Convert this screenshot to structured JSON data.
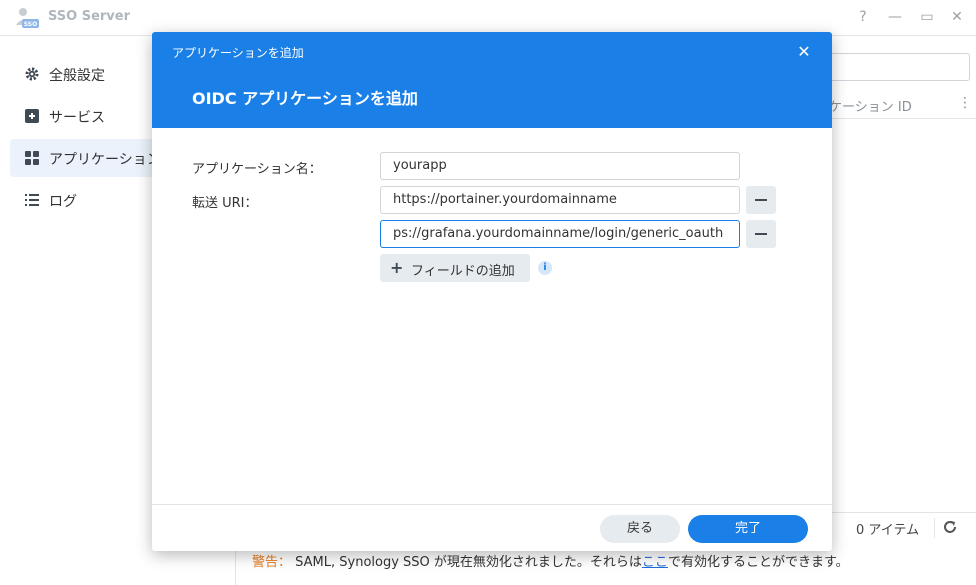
{
  "window": {
    "title": "SSO Server",
    "logo_text": "SSO",
    "help": "?",
    "minimize": "—",
    "maximize": "▭",
    "close": "✕"
  },
  "sidebar": {
    "items": [
      {
        "label": "全般設定",
        "icon": "gear-icon"
      },
      {
        "label": "サービス",
        "icon": "service-icon"
      },
      {
        "label": "アプリケーション",
        "icon": "apps-icon",
        "active": true
      },
      {
        "label": "ログ",
        "icon": "list-icon"
      }
    ]
  },
  "main": {
    "client_id_header": "リケーション ID",
    "more": "⋮",
    "item_count": "0 アイテム",
    "warning": {
      "label": "警告：",
      "text_before": " SAML, Synology SSO が現在無効化されました。それらは",
      "link": "ここ",
      "text_after": "で有効化することができます。"
    }
  },
  "modal": {
    "small_title": "アプリケーションを追加",
    "big_title": "OIDC アプリケーションを追加",
    "close": "✕",
    "app_name_label": "アプリケーション名：",
    "app_name_value": "yourapp",
    "redirect_label": "転送 URI：",
    "redirect_uris": [
      "https://portainer.yourdomainname",
      "ps://grafana.yourdomainname/login/generic_oauth"
    ],
    "add_field_label": "フィールドの追加",
    "add_field_plus": "+",
    "info": "i",
    "back_label": "戻る",
    "done_label": "完了"
  },
  "colors": {
    "accent": "#1a80e8",
    "warning": "#e47a1c",
    "link": "#1f6cd6"
  }
}
